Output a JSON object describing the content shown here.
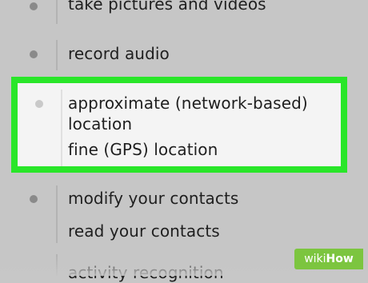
{
  "permissions": {
    "camera": {
      "label": "take pictures and videos"
    },
    "microphone": {
      "label": "record audio"
    },
    "location": {
      "approximate_line1": "approximate (network-based)",
      "approximate_line2": "location",
      "fine": "fine (GPS) location"
    },
    "contacts": {
      "modify": "modify your contacts",
      "read": "read your contacts"
    },
    "activity": {
      "label": "activity recognition"
    }
  },
  "watermark": {
    "wiki": "wiki",
    "how": "How"
  },
  "colors": {
    "highlight": "#29e629",
    "background": "#c6c6c6",
    "watermark": "#7cc53f"
  }
}
